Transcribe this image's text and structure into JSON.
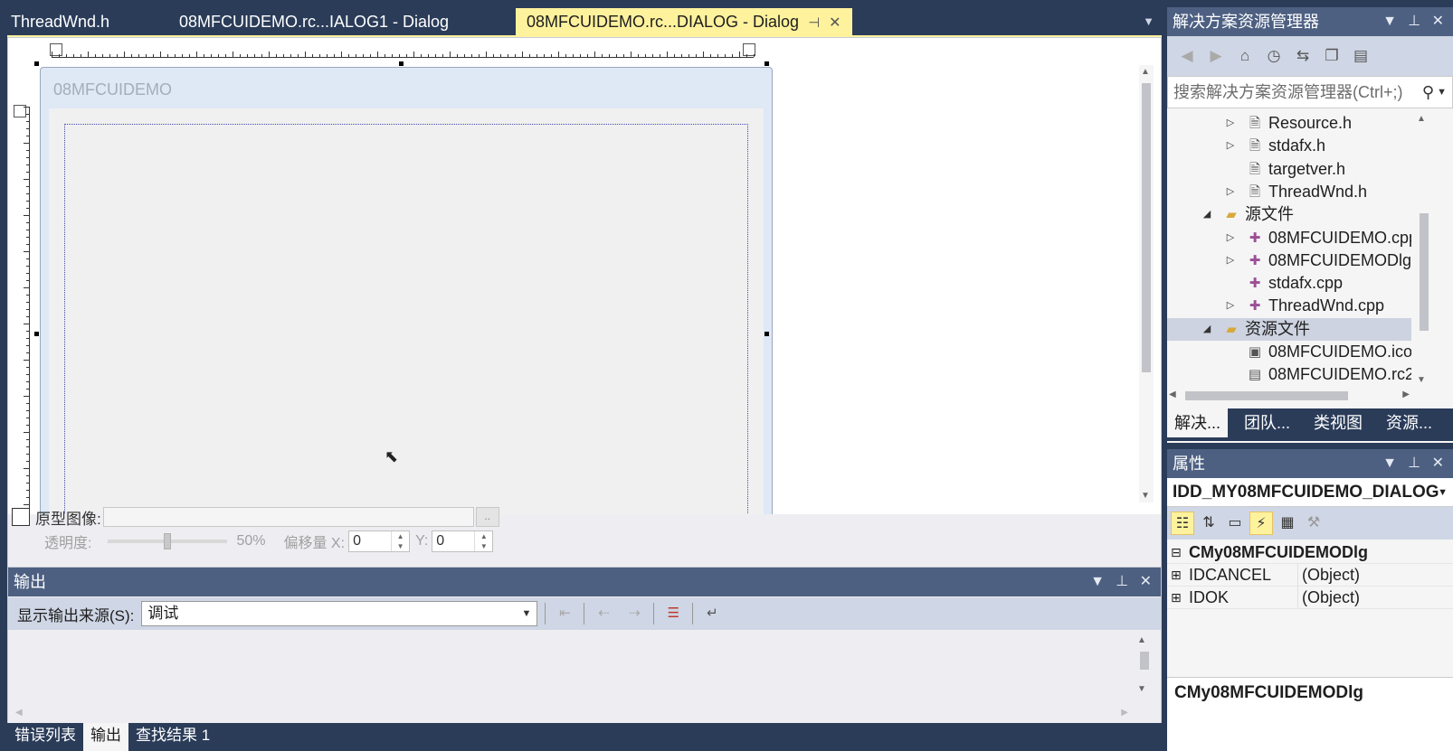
{
  "doc_tabs": [
    {
      "label": "ThreadWnd.h"
    },
    {
      "label": "08MFCUIDEMO.rc...IALOG1 - Dialog"
    },
    {
      "label": "08MFCUIDEMO.rc...DIALOG - Dialog"
    }
  ],
  "dialog": {
    "title": "08MFCUIDEMO"
  },
  "prototype": {
    "label": "原型图像:",
    "browse": "..",
    "opacity_label": "透明度:",
    "opacity_value": "50%",
    "offset_x_label": "偏移量 X:",
    "offset_x": "0",
    "offset_y_label": "Y:",
    "offset_y": "0"
  },
  "output": {
    "title": "输出",
    "source_label": "显示输出来源(S):",
    "source_value": "调试"
  },
  "bottom_tabs": [
    "错误列表",
    "输出",
    "查找结果 1"
  ],
  "solution_explorer": {
    "title": "解决方案资源管理器",
    "search_placeholder": "搜索解决方案资源管理器(Ctrl+;)",
    "tree": [
      {
        "label": "Resource.h",
        "icon": "header-file-icon",
        "expander": "collapsed"
      },
      {
        "label": "stdafx.h",
        "icon": "header-file-icon",
        "expander": "collapsed"
      },
      {
        "label": "targetver.h",
        "icon": "header-file-icon",
        "expander": "none"
      },
      {
        "label": "ThreadWnd.h",
        "icon": "header-file-icon",
        "expander": "collapsed"
      },
      {
        "label": "源文件",
        "icon": "folder-icon",
        "expander": "expanded"
      },
      {
        "label": "08MFCUIDEMO.cpp",
        "icon": "cpp-file-icon",
        "expander": "collapsed"
      },
      {
        "label": "08MFCUIDEMODlg.cpp",
        "icon": "cpp-file-icon",
        "expander": "collapsed"
      },
      {
        "label": "stdafx.cpp",
        "icon": "cpp-file-icon",
        "expander": "none"
      },
      {
        "label": "ThreadWnd.cpp",
        "icon": "cpp-file-icon",
        "expander": "collapsed"
      },
      {
        "label": "资源文件",
        "icon": "folder-icon",
        "expander": "expanded",
        "selected": true
      },
      {
        "label": "08MFCUIDEMO.ico",
        "icon": "image-file-icon",
        "expander": "none"
      },
      {
        "label": "08MFCUIDEMO.rc2",
        "icon": "resource-file-icon",
        "expander": "none"
      }
    ],
    "tabs": [
      "解决...",
      "团队...",
      "类视图",
      "资源..."
    ]
  },
  "properties": {
    "title": "属性",
    "object": "IDD_MY08MFCUIDEMO_DIALOG",
    "rows": [
      {
        "name": "CMy08MFCUIDEMODlg",
        "value": "",
        "type": "category",
        "expander": "⊟"
      },
      {
        "name": "IDCANCEL",
        "value": "(Object)",
        "type": "item",
        "expander": "⊞"
      },
      {
        "name": "IDOK",
        "value": "(Object)",
        "type": "item",
        "expander": "⊞"
      }
    ],
    "description": "CMy08MFCUIDEMODlg"
  },
  "colors": {
    "chrome": "#2b3c59",
    "pane_header": "#4d6082",
    "active_tab": "#fff29d",
    "toolbar": "#cfd6e5"
  }
}
